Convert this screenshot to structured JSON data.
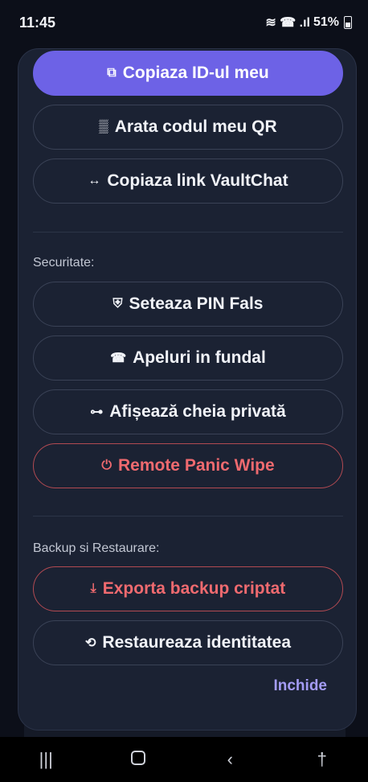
{
  "status_bar": {
    "time": "11:45",
    "signal_icons": "≋ ☎ .ıl",
    "battery_percent": "51%"
  },
  "dialog": {
    "buttons_top": [
      {
        "label": "Copiaza ID-ul meu",
        "icon": "copy-icon",
        "glyph": "⧉",
        "style": "primary"
      },
      {
        "label": "Arata codul meu QR",
        "icon": "qr-icon",
        "glyph": "▒",
        "style": "outline"
      },
      {
        "label": "Copiaza link VaultChat",
        "icon": "link-icon",
        "glyph": "↔",
        "style": "outline"
      }
    ],
    "security_label": "Securitate:",
    "security_buttons": [
      {
        "label": "Seteaza PIN Fals",
        "icon": "shield-icon",
        "glyph": "⛨",
        "style": "outline"
      },
      {
        "label": "Apeluri in fundal",
        "icon": "phone-icon",
        "glyph": "☎",
        "style": "outline"
      },
      {
        "label": "Afișează cheia privată",
        "icon": "key-icon",
        "glyph": "⊶",
        "style": "outline"
      },
      {
        "label": "Remote Panic Wipe",
        "icon": "power-icon",
        "glyph": "⏻",
        "style": "danger"
      }
    ],
    "backup_label": "Backup si Restaurare:",
    "backup_buttons": [
      {
        "label": "Exporta backup criptat",
        "icon": "download-icon",
        "glyph": "⤓",
        "style": "danger"
      },
      {
        "label": "Restaureaza identitatea",
        "icon": "history-icon",
        "glyph": "⟲",
        "style": "outline"
      }
    ],
    "close_label": "Inchide"
  },
  "nav_bar": {
    "recents": "|||",
    "back": "‹",
    "accessibility": "†"
  },
  "colors": {
    "primary": "#6d62e6",
    "danger": "#ef6a6f",
    "link": "#a49cf5",
    "dialog_bg": "#1b2233"
  }
}
